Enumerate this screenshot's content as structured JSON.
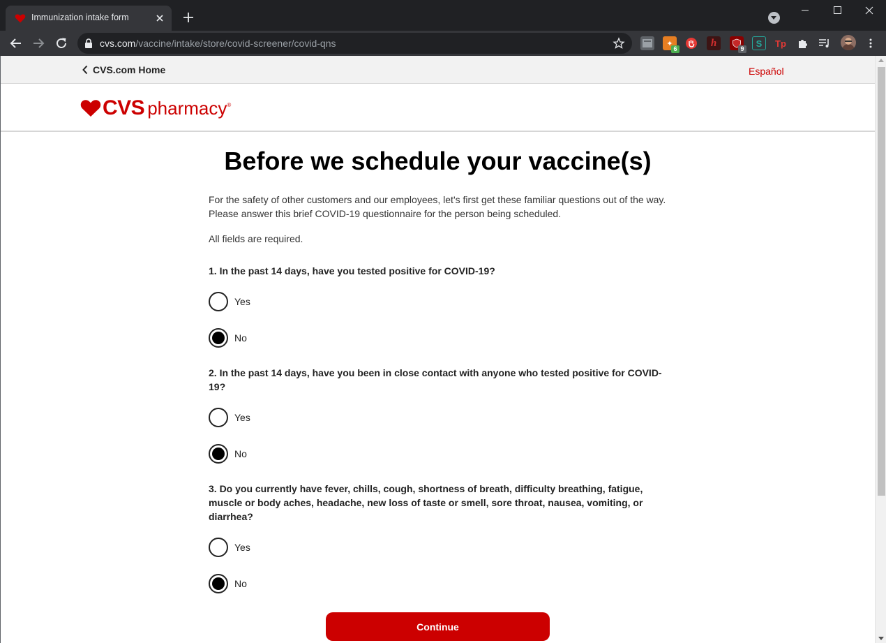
{
  "browser": {
    "tab_title": "Immunization intake form",
    "url_host": "cvs.com",
    "url_path": "/vaccine/intake/store/covid-screener/covid-qns",
    "extensions": [
      {
        "name": "extension-1-icon"
      },
      {
        "name": "extension-2-icon",
        "badge": "6"
      },
      {
        "name": "extension-3-icon"
      },
      {
        "name": "extension-4-icon",
        "label": "h"
      },
      {
        "name": "ublock-icon",
        "badge": "9"
      },
      {
        "name": "extension-s-icon",
        "label": "S"
      },
      {
        "name": "extension-tp-icon",
        "label": "Tp"
      },
      {
        "name": "extensions-puzzle-icon"
      },
      {
        "name": "media-controls-icon"
      },
      {
        "name": "profile-avatar"
      }
    ]
  },
  "header": {
    "home_link": "CVS.com Home",
    "language_link": "Español",
    "logo_cvs": "CVS",
    "logo_pharmacy": "pharmacy"
  },
  "main": {
    "title": "Before we schedule your vaccine(s)",
    "intro_line1": "For the safety of other customers and our employees, let's first get these familiar questions out of the way.",
    "intro_line2": "Please answer this brief COVID-19 questionnaire for the person being scheduled.",
    "required_note": "All fields are required.",
    "questions": [
      {
        "text": "1. In the past 14 days, have you tested positive for COVID-19?",
        "options": [
          "Yes",
          "No"
        ],
        "selected": "No"
      },
      {
        "text": "2. In the past 14 days, have you been in close contact with anyone who tested positive for COVID-19?",
        "options": [
          "Yes",
          "No"
        ],
        "selected": "No"
      },
      {
        "text": "3. Do you currently have fever, chills, cough, shortness of breath, difficulty breathing, fatigue, muscle or body aches, headache, new loss of taste or smell, sore throat, nausea, vomiting, or diarrhea?",
        "options": [
          "Yes",
          "No"
        ],
        "selected": "No"
      }
    ],
    "continue_label": "Continue"
  },
  "colors": {
    "brand_red": "#cc0000",
    "chrome_dark": "#202124",
    "chrome_tab": "#35363a"
  }
}
